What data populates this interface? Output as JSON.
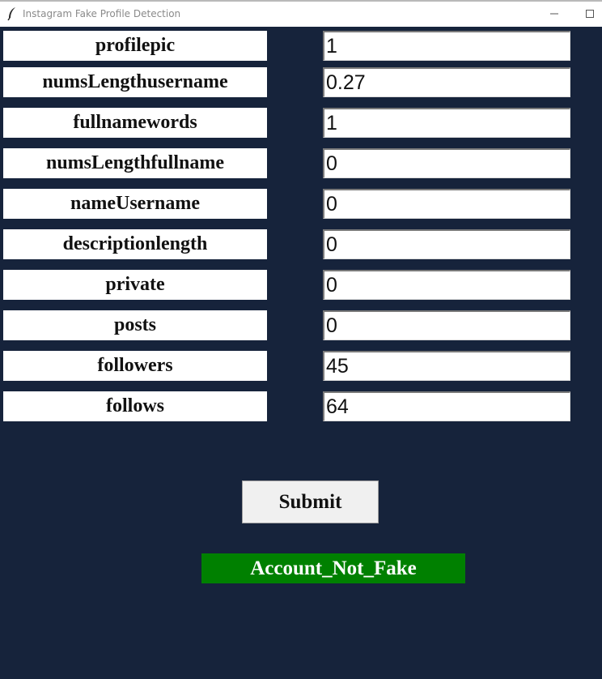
{
  "window": {
    "title": "Instagram Fake Profile Detection",
    "app_icon": "feather-icon",
    "controls": [
      "minimize-icon",
      "maximize-icon"
    ]
  },
  "form": {
    "fields": [
      {
        "label": "profilepic",
        "value": "1"
      },
      {
        "label": "numsLengthusername",
        "value": "0.27"
      },
      {
        "label": "fullnamewords",
        "value": "1"
      },
      {
        "label": "numsLengthfullname",
        "value": "0"
      },
      {
        "label": "nameUsername",
        "value": "0"
      },
      {
        "label": "descriptionlength",
        "value": "0"
      },
      {
        "label": "private",
        "value": "0"
      },
      {
        "label": "posts",
        "value": "0"
      },
      {
        "label": "followers",
        "value": "45"
      },
      {
        "label": "follows",
        "value": "64"
      }
    ],
    "submit_label": "Submit"
  },
  "result": {
    "text": "Account_Not_Fake",
    "color": "#008000"
  },
  "colors": {
    "background": "#16233b"
  }
}
